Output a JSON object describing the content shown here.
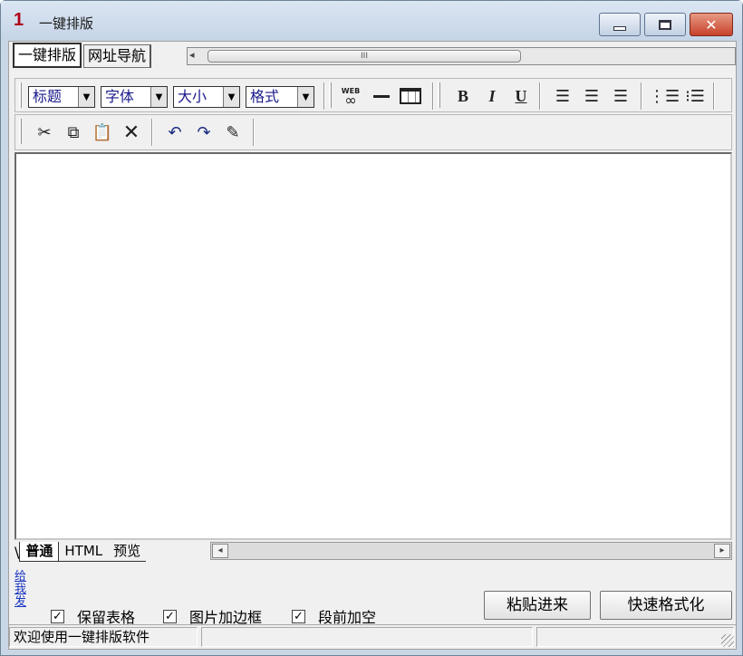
{
  "window": {
    "app_number": "1",
    "title": "一键排版"
  },
  "top_tabs": [
    {
      "label": "一键排版"
    },
    {
      "label": "网址导航"
    }
  ],
  "top_scroll": {
    "thumb_mark": "III"
  },
  "toolbar": {
    "combos": [
      {
        "label": "标题"
      },
      {
        "label": "字体"
      },
      {
        "label": "大小"
      },
      {
        "label": "格式"
      }
    ],
    "icons_row1": [
      "web-link-icon",
      "horizontal-rule-icon",
      "table-icon",
      "bold-icon",
      "italic-icon",
      "underline-icon",
      "align-left-icon",
      "align-center-icon",
      "align-right-icon",
      "numbered-list-icon",
      "bullet-list-icon"
    ],
    "bold": "B",
    "italic": "I",
    "underline": "U",
    "link_text": "WEB",
    "icons_row2": [
      "cut-icon",
      "copy-icon",
      "paste-icon",
      "delete-icon",
      "undo-icon",
      "redo-icon",
      "edit-note-icon"
    ]
  },
  "editor": {
    "content": ""
  },
  "bottom_tabs": [
    {
      "label": "普通"
    },
    {
      "label": "HTML"
    },
    {
      "label": "预览"
    }
  ],
  "side_link": "给我发",
  "options": [
    {
      "label": "保留表格",
      "checked": true
    },
    {
      "label": "图片加边框",
      "checked": true
    },
    {
      "label": "段前加空",
      "checked": true
    }
  ],
  "buttons": {
    "paste": "粘贴进来",
    "format": "快速格式化"
  },
  "status": {
    "message": "欢迎使用一键排版软件",
    "pane2": "",
    "pane3": ""
  }
}
